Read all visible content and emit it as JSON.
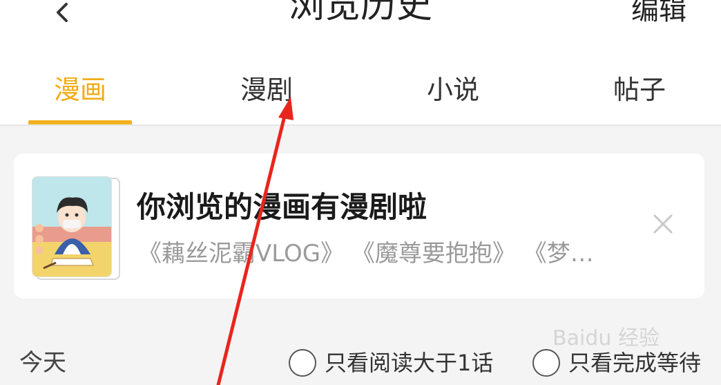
{
  "header": {
    "back_icon": "chevron-left-icon",
    "title": "浏览历史",
    "edit_label": "编辑"
  },
  "tabs": [
    {
      "label": "漫画",
      "active": true
    },
    {
      "label": "漫剧",
      "active": false
    },
    {
      "label": "小说",
      "active": false
    },
    {
      "label": "帖子",
      "active": false
    }
  ],
  "colors": {
    "accent": "#f2ac17",
    "annotation_arrow": "#e8261d"
  },
  "banner": {
    "title": "你浏览的漫画有漫剧啦",
    "subtitle": "《藕丝泥霸VLOG》 《魔尊要抱抱》 《梦…",
    "close_icon": "close-icon",
    "thumbnail": "comic-cover-image"
  },
  "list": {
    "section_label": "今天",
    "filters": [
      {
        "label": "只看阅读大于1话",
        "checked": false
      },
      {
        "label": "只看完成等待",
        "checked": false
      }
    ]
  },
  "watermark": "Baidu 经验"
}
